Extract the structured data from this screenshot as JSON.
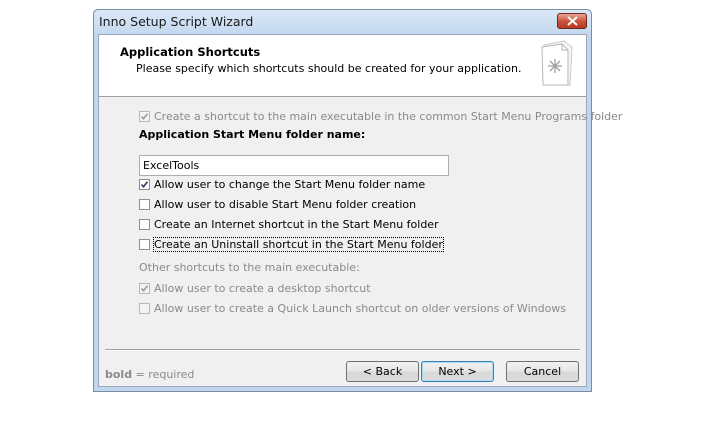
{
  "window": {
    "title": "Inno Setup Script Wizard"
  },
  "header": {
    "title": "Application Shortcuts",
    "subtitle": "Please specify which shortcuts should be created for your application."
  },
  "form": {
    "create_shortcut_label": "Create a shortcut to the main executable in the common Start Menu Programs folder",
    "create_shortcut_checked": true,
    "folder_name_label": "Application Start Menu folder name:",
    "folder_name_value": "ExcelTools",
    "options": [
      {
        "label": "Allow user to change the Start Menu folder name",
        "checked": true
      },
      {
        "label": "Allow user to disable Start Menu folder creation",
        "checked": false
      },
      {
        "label": "Create an Internet shortcut in the Start Menu folder",
        "checked": false
      },
      {
        "label": "Create an Uninstall shortcut in the Start Menu folder",
        "checked": false
      }
    ],
    "other_shortcuts_label": "Other shortcuts to the main executable:",
    "other_options": [
      {
        "label": "Allow user to create a desktop shortcut",
        "checked": true
      },
      {
        "label": "Allow user to create a Quick Launch shortcut on older versions of Windows",
        "checked": false
      }
    ]
  },
  "footer": {
    "bold_word": "bold",
    "required_note": " = required",
    "back_label": "< Back",
    "next_label": "Next >",
    "cancel_label": "Cancel"
  },
  "colors": {
    "title_bar": "#c4d8f0",
    "close_button": "#c84f38",
    "dialog_bg": "#f0f0f0"
  }
}
